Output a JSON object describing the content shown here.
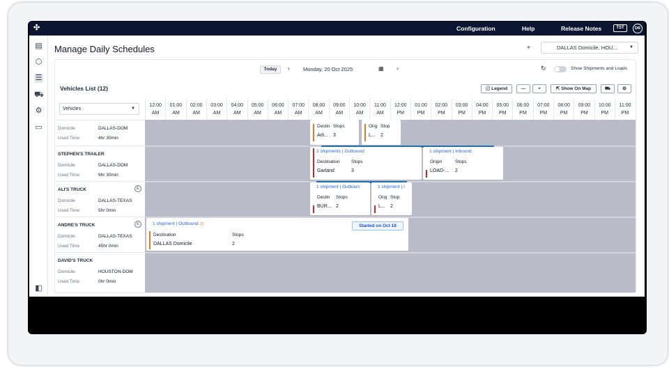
{
  "topbar": {
    "logo": "✣",
    "nav": [
      "Configuration",
      "Help",
      "Release Notes"
    ],
    "env_badge": "TST",
    "avatar_initials": "DR"
  },
  "page": {
    "title": "Manage Daily Schedules",
    "domicile_select": "DALLAS Domicile, HOU..."
  },
  "schedule_toolbar": {
    "today_label": "Today",
    "date": "Monday, 20 Oct 2025",
    "toggle_label": "Show Shipments and Loads",
    "toggle_on": false
  },
  "vehicles_list": {
    "title": "Vehicles List (12)",
    "legend_label": "Legend",
    "zoom_out": "—",
    "zoom_in": "+",
    "show_on_map": "Show On Map",
    "filter_value": "Vehicles"
  },
  "hours": [
    {
      "t": "12:00",
      "p": "AM"
    },
    {
      "t": "01:00",
      "p": "AM"
    },
    {
      "t": "02:00",
      "p": "AM"
    },
    {
      "t": "03:00",
      "p": "AM"
    },
    {
      "t": "04:00",
      "p": "AM"
    },
    {
      "t": "05:00",
      "p": "AM"
    },
    {
      "t": "06:00",
      "p": "AM"
    },
    {
      "t": "07:00",
      "p": "AM"
    },
    {
      "t": "08:00",
      "p": "AM"
    },
    {
      "t": "09:00",
      "p": "AM"
    },
    {
      "t": "10:00",
      "p": "AM"
    },
    {
      "t": "11:00",
      "p": "AM"
    },
    {
      "t": "12:00",
      "p": "PM"
    },
    {
      "t": "01:00",
      "p": "PM"
    },
    {
      "t": "02:00",
      "p": "PM"
    },
    {
      "t": "03:00",
      "p": "PM"
    },
    {
      "t": "04:00",
      "p": "PM"
    },
    {
      "t": "05:00",
      "p": "PM"
    },
    {
      "t": "06:00",
      "p": "PM"
    },
    {
      "t": "07:00",
      "p": "PM"
    },
    {
      "t": "08:00",
      "p": "PM"
    },
    {
      "t": "09:00",
      "p": "PM"
    },
    {
      "t": "10:00",
      "p": "PM"
    },
    {
      "t": "11:00",
      "p": "PM"
    }
  ],
  "labels": {
    "domicile": "Domicile",
    "used_time": "Used Time",
    "e_badge": "E"
  },
  "vehicles": [
    {
      "name": "",
      "domicile": "DALLAS-DOM",
      "used_time": "4hr 30min"
    },
    {
      "name": "STEPHEN'S TRAILER",
      "domicile": "DALLAS-DOM",
      "used_time": "9hr 30min"
    },
    {
      "name": "ALI'S TRUCK",
      "domicile": "DALLAS-TEXAS",
      "used_time": "5hr 0min"
    },
    {
      "name": "ANDRE'S TRUCK",
      "domicile": "DALLAS-TEXAS",
      "used_time": "45hr 0min"
    },
    {
      "name": "DAVID'S TRUCK",
      "domicile": "HOUSTON-DOM",
      "used_time": "0hr 0min"
    }
  ],
  "cards": {
    "c0a": {
      "col1": "Destin",
      "col2": "Stops",
      "v1": "Arli...",
      "v2": "3"
    },
    "c0b": {
      "col1": "Orig",
      "col2": "Stop",
      "v1": "L...",
      "v2": "2"
    },
    "c1a": {
      "header": "2 shipments | Outbound",
      "col1": "Destination",
      "col2": "Stops",
      "v1": "Garland",
      "v2": "3"
    },
    "c1b": {
      "header": "1 shipment | Inbound",
      "col1": "Origin",
      "col2": "Stops",
      "v1": "LOAD-...",
      "v2": "2"
    },
    "c2a": {
      "header": "1 shipment | Outboun",
      "col1": "Destin",
      "col2": "Stops",
      "v1": "BUR...",
      "v2": "2"
    },
    "c2b": {
      "header": "1 shipment | I",
      "col1": "Orig",
      "col2": "Stop",
      "v1": "L...",
      "v2": "2"
    },
    "c3a": {
      "header": "1 shipment | Outbound",
      "col1": "Destination",
      "col2": "Stops",
      "v1": "DALLAS Domicile",
      "v2": "2",
      "status": "Started on Oct 18"
    }
  }
}
